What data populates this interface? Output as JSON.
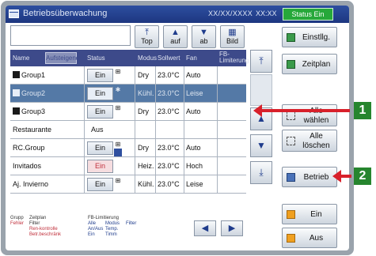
{
  "titlebar": {
    "title": "Betriebsüberwachung",
    "date": "XX/XX/XXXX",
    "time": "XX:XX",
    "status": "Status Ein"
  },
  "toolbar": {
    "top": "Top",
    "up": "auf",
    "down": "ab",
    "image": "Bild"
  },
  "columns": {
    "name": "Name",
    "sort": "Aufsteigend",
    "status": "Status",
    "mode": "Modus",
    "setpoint": "Sollwert",
    "fan": "Fan",
    "fb": "FB-Limiterung"
  },
  "rows": [
    {
      "name": "Group1",
      "status": "Ein",
      "mode": "Dry",
      "setpoint": "23.0°C",
      "fan": "Auto",
      "sub": "⊞"
    },
    {
      "name": "Group2",
      "status": "Ein",
      "mode": "Kühl.",
      "setpoint": "23.0°C",
      "fan": "Leise",
      "sub": "✱"
    },
    {
      "name": "Group3",
      "status": "Ein",
      "mode": "Dry",
      "setpoint": "23.0°C",
      "fan": "Auto",
      "sub": "⊞"
    },
    {
      "name": "Restaurante",
      "status": "Aus",
      "mode": "",
      "setpoint": "",
      "fan": "",
      "sub": ""
    },
    {
      "name": "RC.Group",
      "status": "Ein",
      "mode": "Dry",
      "setpoint": "23.0°C",
      "fan": "Auto",
      "sub": "⊞"
    },
    {
      "name": "Invitados",
      "status": "Ein",
      "mode": "Heiz.",
      "setpoint": "23.0°C",
      "fan": "Hoch",
      "sub": ""
    },
    {
      "name": "Aj. Invierno",
      "status": "Ein",
      "mode": "Kühl.",
      "setpoint": "23.0°C",
      "fan": "Leise",
      "sub": "⊞"
    }
  ],
  "side": {
    "settings": "Einstllg.",
    "schedule": "Zeitplan",
    "select_all": "Alle wählen",
    "clear_all": "Alle löschen",
    "operation": "Betrieb",
    "on": "Ein",
    "off": "Aus"
  },
  "legend": {
    "group": "Grupp",
    "schedule": "Zeitplan",
    "error": "Fehler",
    "filter": "Filter",
    "ren_control": "Ren-kontrolle",
    "op_restrict": "Betr.beschränk",
    "fb_limit": "FB-Limitierung",
    "l1": "Alle",
    "l2": "Modus",
    "l3": "Filter",
    "l4": "An/Aus",
    "l5": "Temp.",
    "l6": "Ein",
    "l7": "Timm"
  },
  "callouts": {
    "one": "1",
    "two": "2"
  },
  "colors": {
    "title_bar": "#1d3680",
    "selected_row": "#5479a6",
    "status_green": "#26a83a",
    "callout_red": "#d8202a",
    "callout_green": "#26852e"
  }
}
